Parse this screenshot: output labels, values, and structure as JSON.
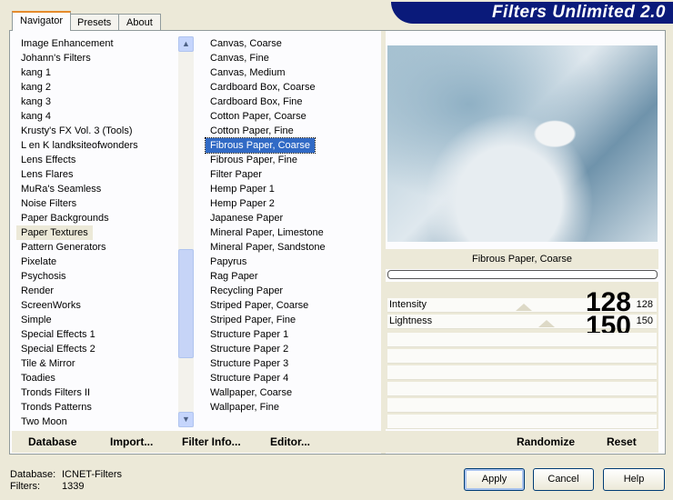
{
  "app": {
    "title": "Filters Unlimited 2.0"
  },
  "tabs": [
    {
      "label": "Navigator"
    },
    {
      "label": "Presets"
    },
    {
      "label": "About"
    }
  ],
  "categories": [
    "Image Enhancement",
    "Johann's Filters",
    "kang 1",
    "kang 2",
    "kang 3",
    "kang 4",
    "Krusty's FX Vol. 3 (Tools)",
    "L en K landksiteofwonders",
    "Lens Effects",
    "Lens Flares",
    "MuRa's Seamless",
    "Noise Filters",
    "Paper Backgrounds",
    "Paper Textures",
    "Pattern Generators",
    "Pixelate",
    "Psychosis",
    "Render",
    "ScreenWorks",
    "Simple",
    "Special Effects 1",
    "Special Effects 2",
    "Tile & Mirror",
    "Toadies",
    "Tronds Filters II",
    "Tronds Patterns",
    "Two Moon"
  ],
  "selected_category": "Paper Textures",
  "filters": [
    "Canvas, Coarse",
    "Canvas, Fine",
    "Canvas, Medium",
    "Cardboard Box, Coarse",
    "Cardboard Box, Fine",
    "Cotton Paper, Coarse",
    "Cotton Paper, Fine",
    "Fibrous Paper, Coarse",
    "Fibrous Paper, Fine",
    "Filter Paper",
    "Hemp Paper 1",
    "Hemp Paper 2",
    "Japanese Paper",
    "Mineral Paper, Limestone",
    "Mineral Paper, Sandstone",
    "Papyrus",
    "Rag Paper",
    "Recycling Paper",
    "Striped Paper, Coarse",
    "Striped Paper, Fine",
    "Structure Paper 1",
    "Structure Paper 2",
    "Structure Paper 3",
    "Structure Paper 4",
    "Wallpaper, Coarse",
    "Wallpaper, Fine"
  ],
  "selected_filter": "Fibrous Paper, Coarse",
  "preview": {
    "filter_name": "Fibrous Paper, Coarse",
    "progress": 0
  },
  "params": [
    {
      "label": "Intensity",
      "value": "128",
      "max": 255
    },
    {
      "label": "Lightness",
      "value": "150",
      "max": 255
    }
  ],
  "bottom_left": {
    "database": "Database",
    "import": "Import...",
    "filter_info": "Filter Info...",
    "editor": "Editor..."
  },
  "bottom_right": {
    "randomize": "Randomize",
    "reset": "Reset"
  },
  "status": {
    "database_label": "Database:",
    "database_value": "ICNET-Filters",
    "filters_label": "Filters:",
    "filters_value": "1339"
  },
  "buttons": {
    "apply": "Apply",
    "cancel": "Cancel",
    "help": "Help"
  },
  "colors": {
    "banner": "#0a1a7a",
    "selection": "#316ac5",
    "tab_accent": "#e68b2c"
  }
}
